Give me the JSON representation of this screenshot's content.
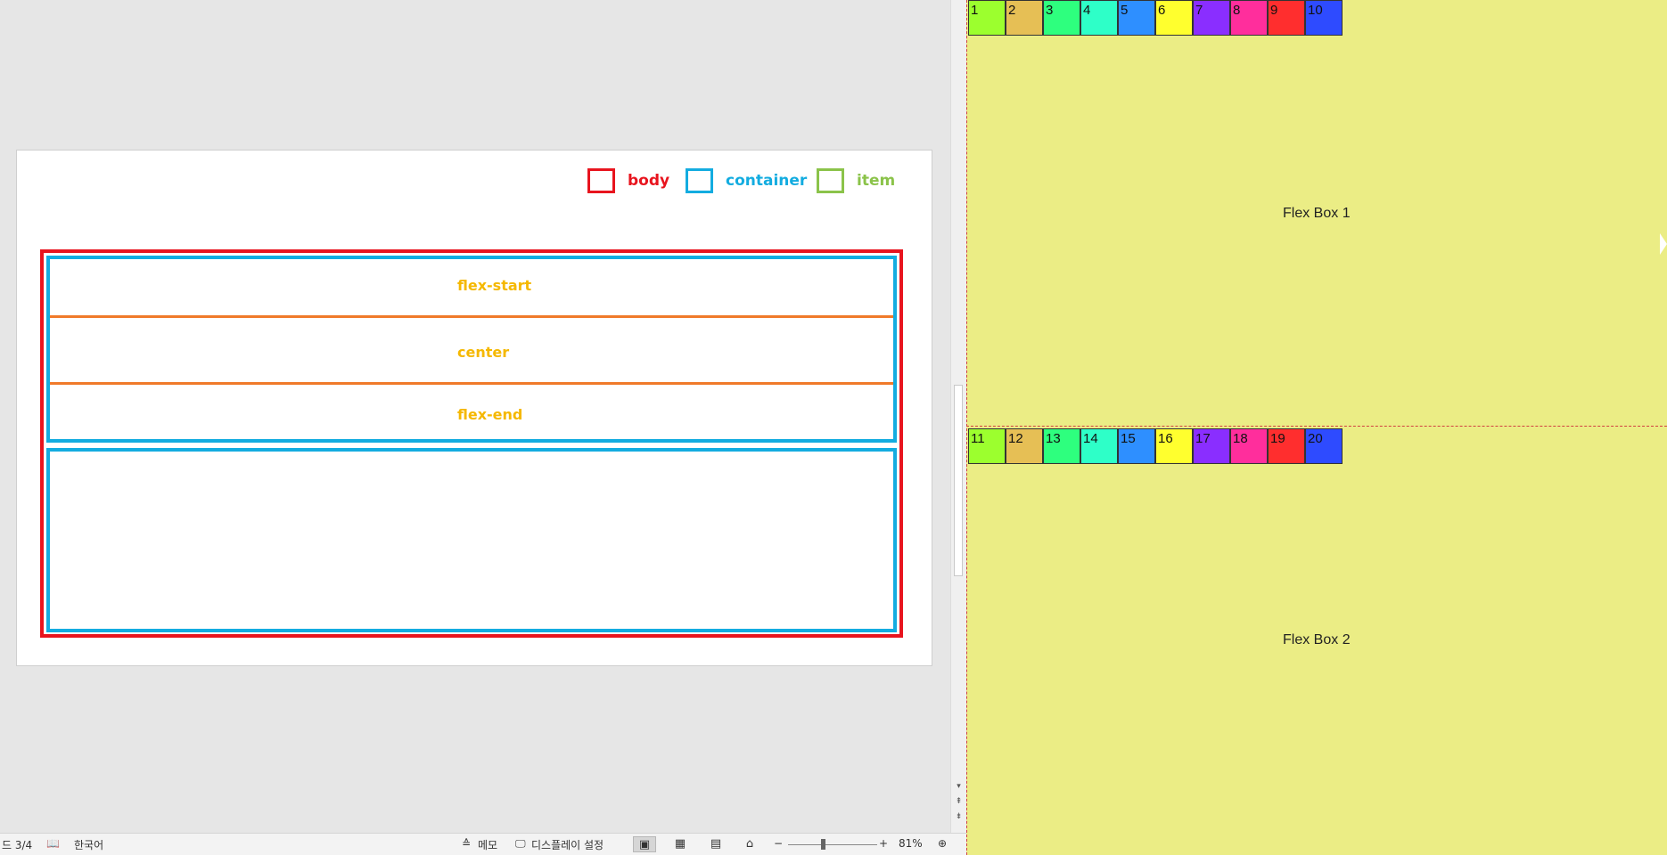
{
  "legend": {
    "body": "body",
    "container": "container",
    "item": "item"
  },
  "slide_rows": {
    "start": "flex-start",
    "center": "center",
    "end": "flex-end"
  },
  "status": {
    "slide": "드 3/4",
    "language": "한국어",
    "memo": "메모",
    "display": "디스플레이 설정",
    "zoom": "81%",
    "zoom_minus": "−",
    "zoom_plus": "+"
  },
  "browser": {
    "box1_label": "Flex Box 1",
    "box2_label": "Flex Box 2",
    "row1": [
      {
        "label": "1",
        "color": "#9cff2e"
      },
      {
        "label": "2",
        "color": "#e6bf55"
      },
      {
        "label": "3",
        "color": "#2eff7e"
      },
      {
        "label": "4",
        "color": "#2effc8"
      },
      {
        "label": "5",
        "color": "#2e8fff"
      },
      {
        "label": "6",
        "color": "#ffff2e"
      },
      {
        "label": "7",
        "color": "#8a2eff"
      },
      {
        "label": "8",
        "color": "#ff2e9c"
      },
      {
        "label": "9",
        "color": "#ff2e2e"
      },
      {
        "label": "10",
        "color": "#2e4bff"
      }
    ],
    "row2": [
      {
        "label": "11",
        "color": "#9cff2e"
      },
      {
        "label": "12",
        "color": "#e6bf55"
      },
      {
        "label": "13",
        "color": "#2eff7e"
      },
      {
        "label": "14",
        "color": "#2effc8"
      },
      {
        "label": "15",
        "color": "#2e8fff"
      },
      {
        "label": "16",
        "color": "#ffff2e"
      },
      {
        "label": "17",
        "color": "#8a2eff"
      },
      {
        "label": "18",
        "color": "#ff2e9c"
      },
      {
        "label": "19",
        "color": "#ff2e2e"
      },
      {
        "label": "20",
        "color": "#2e4bff"
      }
    ]
  }
}
